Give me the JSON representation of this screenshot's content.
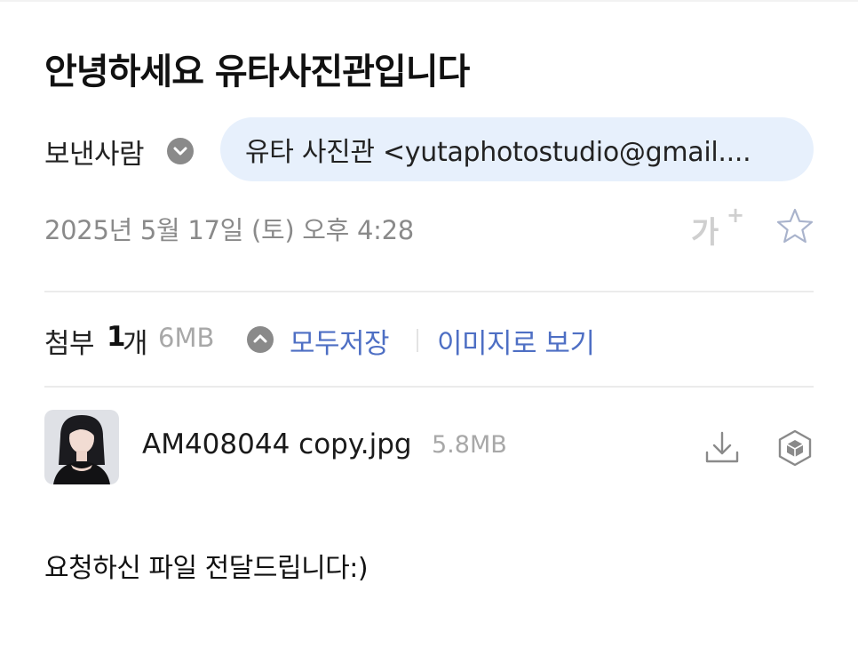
{
  "email": {
    "subject": "안녕하세요 유타사진관입니다",
    "sender": {
      "label": "보낸사람",
      "toggle_icon": "chevron-down-icon",
      "value": "유타 사진관 <yutaphotostudio@gmail...."
    },
    "date": "2025년 5월 17일 (토) 오후 4:28",
    "actions": {
      "font_size_label": "가",
      "font_size_plus": "+",
      "star_icon": "star-outline-icon"
    }
  },
  "attachments": {
    "label": "첨부",
    "count": "1",
    "count_unit": "개",
    "total_size": "6MB",
    "toggle_icon": "chevron-up-icon",
    "save_all_label": "모두저장",
    "view_as_image_label": "이미지로 보기",
    "files": [
      {
        "name": "AM408044 copy.jpg",
        "size": "5.8MB",
        "thumbnail_icon": "photo-thumbnail",
        "download_icon": "download-icon",
        "cube_icon": "cube-icon"
      }
    ]
  },
  "body": {
    "text": "요청하신 파일 전달드립니다:)"
  },
  "colors": {
    "link": "#4e6fc4",
    "chip_background": "#e7f0fc",
    "muted": "#8a8a8a"
  }
}
